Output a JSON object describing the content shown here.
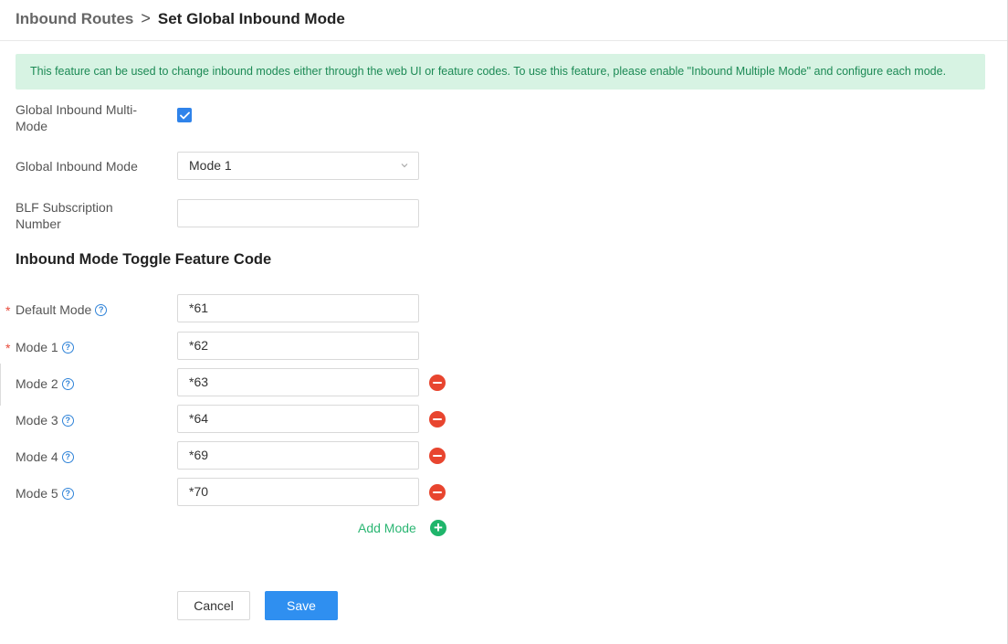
{
  "breadcrumb": {
    "parent": "Inbound Routes",
    "separator": ">",
    "current": "Set Global Inbound Mode"
  },
  "notice": "This feature can be used to change inbound modes either through the web UI or feature codes. To use this feature, please enable \"Inbound Multiple Mode\" and configure each mode.",
  "form": {
    "multi_mode": {
      "label_line1": "Global Inbound Multi-",
      "label_line2": "Mode",
      "checked": true
    },
    "inbound_mode": {
      "label": "Global Inbound Mode",
      "value": "Mode 1"
    },
    "blf": {
      "label_line1": "BLF Subscription",
      "label_line2": "Number",
      "value": ""
    }
  },
  "section_title": "Inbound Mode Toggle Feature Code",
  "modes": [
    {
      "label": "Default Mode",
      "value": "*61",
      "required": "*",
      "removable": false
    },
    {
      "label": "Mode 1",
      "value": "*62",
      "required": "*",
      "removable": false
    },
    {
      "label": "Mode 2",
      "value": "*63",
      "required": "",
      "removable": true
    },
    {
      "label": "Mode 3",
      "value": "*64",
      "required": "",
      "removable": true
    },
    {
      "label": "Mode 4",
      "value": "*69",
      "required": "",
      "removable": true
    },
    {
      "label": "Mode 5",
      "value": "*70",
      "required": "",
      "removable": true
    }
  ],
  "add_mode_label": "Add Mode",
  "buttons": {
    "cancel": "Cancel",
    "save": "Save"
  },
  "colors": {
    "primary": "#2f8ff0",
    "success": "#1fb56b",
    "danger": "#e8452f",
    "notice_bg": "#d7f3e3"
  },
  "icons": {
    "info": "info-circle-icon",
    "remove": "minus-circle-icon",
    "add": "plus-circle-icon",
    "check": "check-icon",
    "dropdown": "chevron-down-icon"
  }
}
